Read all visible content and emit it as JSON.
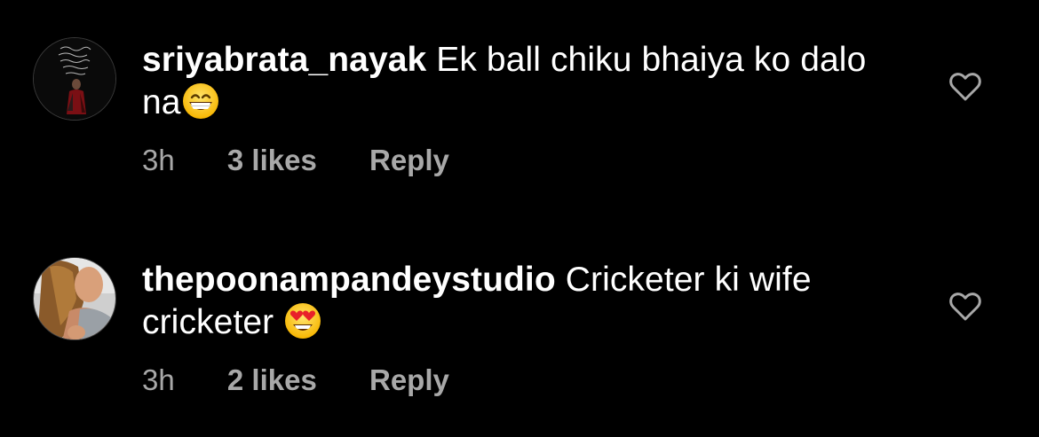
{
  "comments": [
    {
      "username": "sriyabrata_nayak",
      "text": "Ek ball chiku bhaiya ko dalo na",
      "emoji": "grinning-face-with-smiling-eyes-icon",
      "time": "3h",
      "likes": "3 likes",
      "reply_label": "Reply"
    },
    {
      "username": "thepoonampandeystudio",
      "text": "Cricketer ki wife cricketer",
      "emoji": "heart-eyes-face-icon",
      "time": "3h",
      "likes": "2 likes",
      "reply_label": "Reply"
    }
  ],
  "colors": {
    "background": "#000000",
    "text": "#ffffff",
    "secondary_text": "#a8a8a8",
    "heart_outline": "#a8a8a8"
  }
}
